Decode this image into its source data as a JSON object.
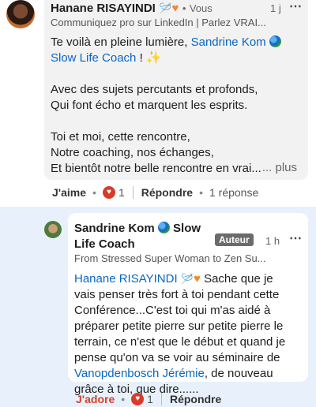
{
  "comment1": {
    "author": "Hanane RISAYINDI",
    "author_emojis": "🪡🧡",
    "meta_sep": "•",
    "degree": "Vous",
    "time": "1 j",
    "more_menu": "⋯",
    "headline": "Communiquez pro sur LinkedIn | Parlez VRAI...",
    "text_line1_a": "Te voilà en pleine lumière,",
    "mention": "Sandrine Kom",
    "mention_line2": "Slow Life Coach",
    "text_line1_b": "!",
    "para2_line1": "Avec des sujets percutants et profonds,",
    "para2_line2": "Qui font écho et marquent les esprits.",
    "para3_line1": "Toi et moi, cette rencontre,",
    "para3_line2": "Notre coaching, nos échanges,",
    "para3_line3": "Et bientôt notre belle rencontre en vrai...",
    "more": "... plus",
    "like_label": "J'aime",
    "reaction_count": "1",
    "reply_label": "Répondre",
    "reply_count": "1 réponse"
  },
  "comment2": {
    "author_line1": "Sandrine Kom",
    "author_line1_b": "Slow",
    "author_line2": "Life Coach",
    "badge": "Auteur",
    "time": "1 h",
    "headline": "From Stressed Super Woman to Zen Su...",
    "mention": "Hanane RISAYINDI",
    "lines": [
      "Sache que je",
      "vais penser très fort à toi pendant cette",
      "Conférence...C'est toi qui m'as aidé à",
      "préparer petite pierre sur petite pierre le",
      "terrain, ce n'est que le début et quand je",
      "pense qu'on va se voir au séminaire de"
    ],
    "mention2": "Vanopdenbosch Jérémie",
    "line_after_mention2": ", de nouveau",
    "last_line": "grâce à toi, que dire......",
    "like_label": "J'adore",
    "reaction_count": "1",
    "reply_label": "Répondre"
  }
}
